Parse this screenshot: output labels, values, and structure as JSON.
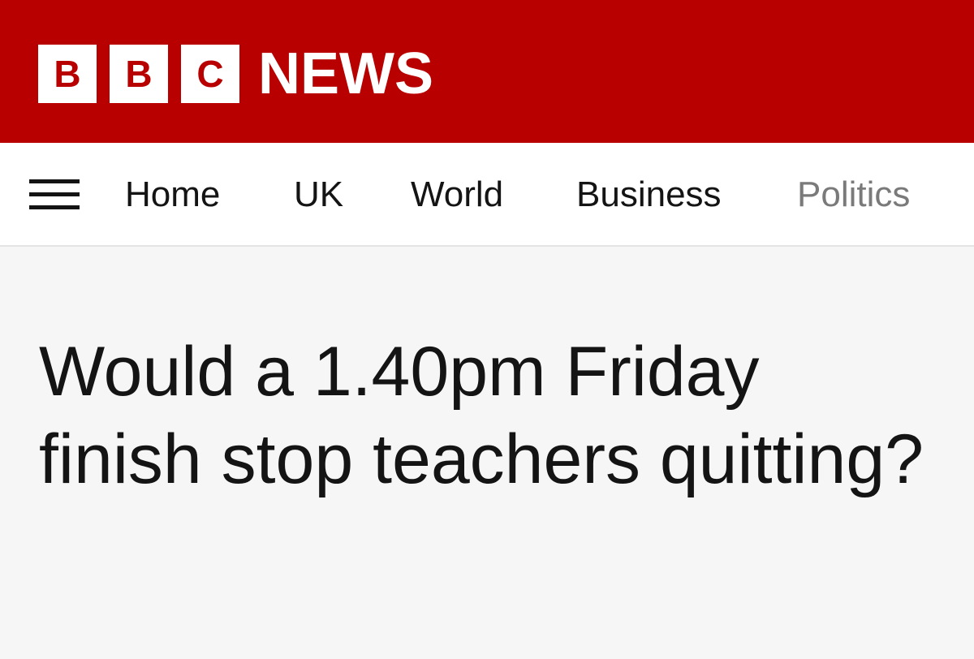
{
  "header": {
    "logo_letters": [
      "B",
      "B",
      "C"
    ],
    "brand_word": "NEWS",
    "colors": {
      "brand_red": "#b80000",
      "logo_block": "#ffffff"
    }
  },
  "nav": {
    "menu_icon": "hamburger-menu-icon",
    "items": [
      {
        "label": "Home"
      },
      {
        "label": "UK"
      },
      {
        "label": "World"
      },
      {
        "label": "Business"
      },
      {
        "label": "Politics"
      }
    ]
  },
  "article": {
    "headline": "Would a 1.40pm Friday finish stop teachers quitting?"
  }
}
